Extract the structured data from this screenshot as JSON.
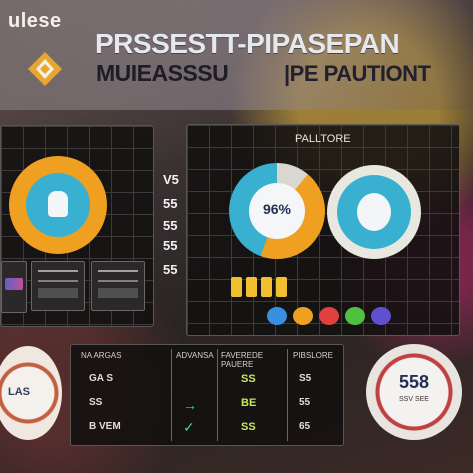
{
  "header": {
    "brand": "ulese",
    "title_line1": "PRSSESTT-PIPASEPAN",
    "title_line2a": "MUIEASSSU",
    "title_line2b": "|PE PAUTIONT"
  },
  "center_panel": {
    "title": "PALLTORE",
    "donut_left_value": "96%",
    "side_labels": [
      "V5",
      "55",
      "55",
      "55",
      "55"
    ]
  },
  "bottom_table": {
    "headers": [
      "NA ARGAS",
      "ADVANSA",
      "FAVEREDE PAUERE",
      "PIBSLORE"
    ],
    "rows": [
      [
        "GA S",
        "SS",
        "S5"
      ],
      [
        "SS",
        "BE",
        "55"
      ],
      [
        "B VEM",
        "SS",
        "65"
      ]
    ]
  },
  "right_badge": {
    "value": "558",
    "label": "SSV SEE"
  },
  "left_badge": {
    "label": "LAS"
  },
  "colors": {
    "accent_orange": "#f0a020",
    "accent_teal": "#3ab0d0",
    "accent_yellow": "#f0c030"
  }
}
